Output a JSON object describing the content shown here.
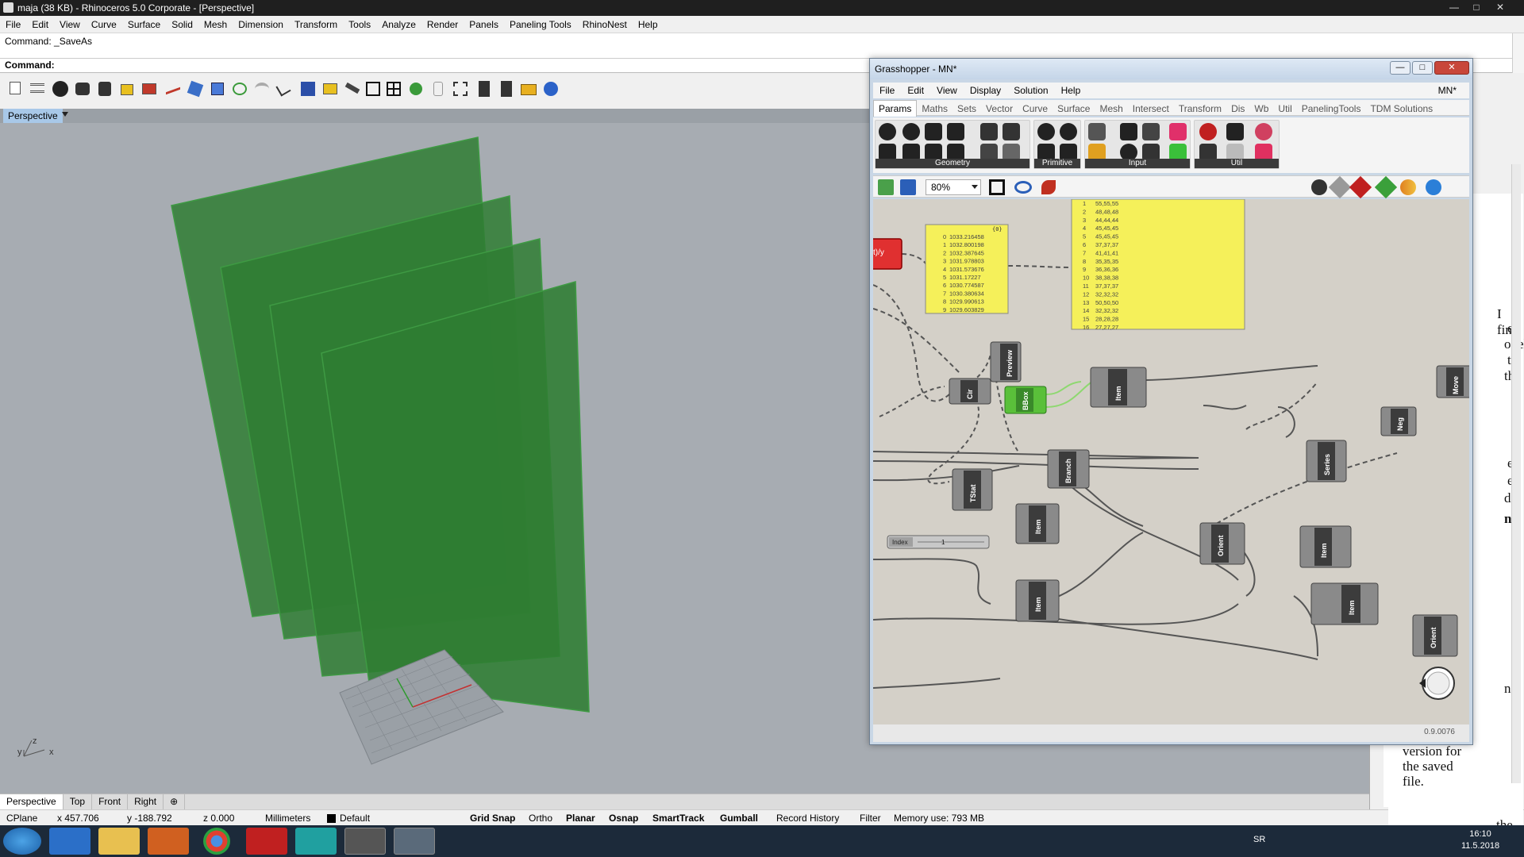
{
  "rhino": {
    "title": "maja (38 KB) - Rhinoceros  5.0 Corporate - [Perspective]",
    "menu": [
      "File",
      "Edit",
      "View",
      "Curve",
      "Surface",
      "Solid",
      "Mesh",
      "Dimension",
      "Transform",
      "Tools",
      "Analyze",
      "Render",
      "Panels",
      "Paneling Tools",
      "RhinoNest",
      "Help"
    ],
    "command_history": "Command: _SaveAs",
    "command_prompt": "Command:",
    "viewport_label": "Perspective",
    "viewport_tabs": [
      "Perspective",
      "Top",
      "Front",
      "Right"
    ],
    "axis_labels": {
      "x": "x",
      "y": "y",
      "z": "z"
    },
    "accent_surface": "#2f7d32"
  },
  "status": {
    "cplane": "CPlane",
    "x": "x 457.706",
    "y": "y -188.792",
    "z": "z 0.000",
    "units": "Millimeters",
    "layer": "Default",
    "toggles": [
      "Grid Snap",
      "Ortho",
      "Planar",
      "Osnap",
      "SmartTrack",
      "Gumball",
      "Record History",
      "Filter"
    ],
    "memory": "Memory use: 793 MB"
  },
  "right_panel": {
    "snippets": [
      "I find",
      "es",
      "odel",
      "t",
      "the",
      "e",
      "e",
      "d.",
      "ne",
      "nd",
      "the",
      "version for",
      "the saved",
      "file."
    ]
  },
  "taskbar": {
    "lang": "SR",
    "time": "16:10",
    "date": "11.5.2018"
  },
  "grasshopper": {
    "title": "Grasshopper - MN*",
    "document": "MN*",
    "menu": [
      "File",
      "Edit",
      "View",
      "Display",
      "Solution",
      "Help"
    ],
    "tabs": [
      "Params",
      "Maths",
      "Sets",
      "Vector",
      "Curve",
      "Surface",
      "Mesh",
      "Intersect",
      "Transform",
      "Dis",
      "Wb",
      "Util",
      "PanelingTools",
      "TDM Solutions"
    ],
    "ribbon_groups": [
      "Geometry",
      "Primitive",
      "Input",
      "Util"
    ],
    "zoom": "80%",
    "version": "0.9.0076",
    "panel_small": {
      "header": "{0}",
      "rows": [
        [
          "0",
          "1033.216458"
        ],
        [
          "1",
          "1032.800198"
        ],
        [
          "2",
          "1032.387645"
        ],
        [
          "3",
          "1031.978803"
        ],
        [
          "4",
          "1031.573676"
        ],
        [
          "5",
          "1031.17227"
        ],
        [
          "6",
          "1030.774587"
        ],
        [
          "7",
          "1030.380634"
        ],
        [
          "8",
          "1029.990613"
        ],
        [
          "9",
          "1029.603829"
        ]
      ]
    },
    "panel_large": {
      "rows": [
        [
          "1",
          "55,55,55"
        ],
        [
          "2",
          "48,48,48"
        ],
        [
          "3",
          "44,44,44"
        ],
        [
          "4",
          "45,45,45"
        ],
        [
          "5",
          "45,45,45"
        ],
        [
          "6",
          "37,37,37"
        ],
        [
          "7",
          "41,41,41"
        ],
        [
          "8",
          "35,35,35"
        ],
        [
          "9",
          "36,36,36"
        ],
        [
          "10",
          "38,38,38"
        ],
        [
          "11",
          "37,37,37"
        ],
        [
          "12",
          "32,32,32"
        ],
        [
          "13",
          "50,50,50"
        ],
        [
          "14",
          "32,32,32"
        ],
        [
          "15",
          "28,28,28"
        ],
        [
          "16",
          "27,27,27"
        ]
      ]
    },
    "components": {
      "division": "t)/y",
      "preview": "Preview",
      "circle": "Cir",
      "bbox": "BBox",
      "item": "Item",
      "move": "Move",
      "neg": "Neg",
      "series": "Series",
      "branch": "Branch",
      "tstat": "TStat",
      "orient": "Orient",
      "index_label": "Index",
      "index_value": "1"
    }
  }
}
